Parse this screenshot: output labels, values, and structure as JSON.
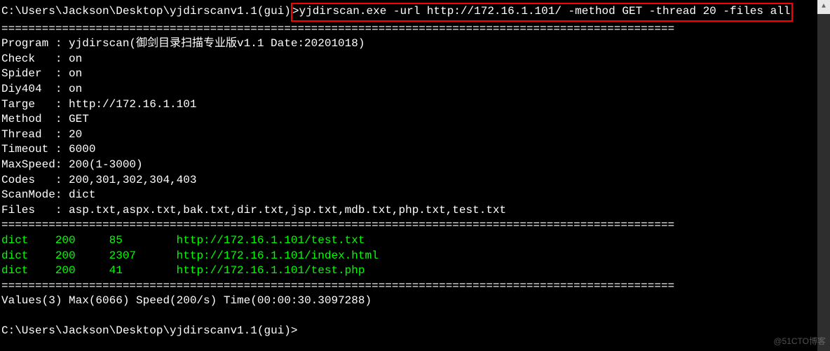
{
  "prompt1_path": "C:\\Users\\Jackson\\Desktop\\yjdirscanv1.1(gui)",
  "prompt1_gt": ">",
  "command": "yjdirscan.exe -url http://172.16.1.101/ -method GET -thread 20 -files all",
  "divider": "====================================================================================================",
  "config": {
    "program_label": "Program : ",
    "program_value": "yjdirscan(御剑目录扫描专业版v1.1 Date:20201018)",
    "check_label": "Check   : ",
    "check_value": "on",
    "spider_label": "Spider  : ",
    "spider_value": "on",
    "diy404_label": "Diy404  : ",
    "diy404_value": "on",
    "targe_label": "Targe   : ",
    "targe_value": "http://172.16.1.101",
    "method_label": "Method  : ",
    "method_value": "GET",
    "thread_label": "Thread  : ",
    "thread_value": "20",
    "timeout_label": "Timeout : ",
    "timeout_value": "6000",
    "maxspeed_label": "MaxSpeed: ",
    "maxspeed_value": "200(1-3000)",
    "codes_label": "Codes   : ",
    "codes_value": "200,301,302,304,403",
    "scanmode_label": "ScanMode: ",
    "scanmode_value": "dict",
    "files_label": "Files   : ",
    "files_value": "asp.txt,aspx.txt,bak.txt,dir.txt,jsp.txt,mdb.txt,php.txt,test.txt"
  },
  "results": [
    {
      "mode": "dict",
      "code": "200",
      "size": "85",
      "url": "http://172.16.1.101/test.txt"
    },
    {
      "mode": "dict",
      "code": "200",
      "size": "2307",
      "url": "http://172.16.1.101/index.html"
    },
    {
      "mode": "dict",
      "code": "200",
      "size": "41",
      "url": "http://172.16.1.101/test.php"
    }
  ],
  "summary": "Values(3) Max(6066) Speed(200/s) Time(00:00:30.3097288)",
  "prompt2": "C:\\Users\\Jackson\\Desktop\\yjdirscanv1.1(gui)>",
  "watermark": "@51CTO博客",
  "scroll_up": "▲"
}
